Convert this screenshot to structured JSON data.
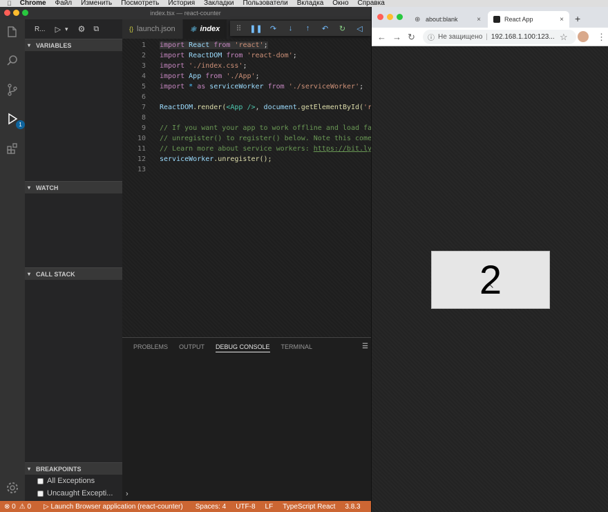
{
  "macos_menubar": {
    "app_name": "Chrome",
    "items": [
      "Файл",
      "Изменить",
      "Посмотреть",
      "История",
      "Закладки",
      "Пользователи",
      "Вкладка",
      "Окно",
      "Справка"
    ]
  },
  "vscode": {
    "title": "index.tsx — react-counter",
    "activity_badge": "1",
    "debug_config": "R...",
    "sections": {
      "variables": "VARIABLES",
      "watch": "WATCH",
      "call_stack": "CALL STACK",
      "breakpoints": "BREAKPOINTS"
    },
    "breakpoints": [
      {
        "label": "All Exceptions",
        "checked": false
      },
      {
        "label": "Uncaught Excepti...",
        "checked": false
      }
    ],
    "tabs": [
      {
        "icon": "{}",
        "label": "launch.json"
      },
      {
        "icon": "⚛",
        "label": "index"
      }
    ],
    "code_lines": [
      {
        "n": "1"
      },
      {
        "n": "2"
      },
      {
        "n": "3"
      },
      {
        "n": "4"
      },
      {
        "n": "5"
      },
      {
        "n": "6"
      },
      {
        "n": "7"
      },
      {
        "n": "8"
      },
      {
        "n": "9"
      },
      {
        "n": "10"
      },
      {
        "n": "11"
      },
      {
        "n": "12"
      },
      {
        "n": "13"
      }
    ],
    "code": {
      "l1": {
        "kw1": "import",
        "name": "React",
        "kw2": "from",
        "str": "'react'",
        "end": ";"
      },
      "l2": {
        "kw1": "import",
        "name": "ReactDOM",
        "kw2": "from",
        "str": "'react-dom'",
        "end": ";"
      },
      "l3": {
        "kw1": "import",
        "str": "'./index.css'",
        "end": ";"
      },
      "l4": {
        "kw1": "import",
        "name": "App",
        "kw2": "from",
        "str": "'./App'",
        "end": ";"
      },
      "l5": {
        "kw1": "import",
        "star": "*",
        "as": "as",
        "name": "serviceWorker",
        "kw2": "from",
        "str": "'./serviceWorker'",
        "end": ";"
      },
      "l7": {
        "obj": "ReactDOM",
        "method": ".render(",
        "tag": "<App />",
        "mid": ", ",
        "doc": "document",
        "get": ".getElementById(",
        "str": "'r"
      },
      "l9": "// If you want your app to work offline and load fa",
      "l10": "// unregister() to register() below. Note this come",
      "l11_text": "// Learn more about service workers: ",
      "l11_link": "https://bit.ly",
      "l12": {
        "obj": "serviceWorker",
        "call": ".unregister();"
      }
    },
    "panel_tabs": [
      "PROBLEMS",
      "OUTPUT",
      "DEBUG CONSOLE",
      "TERMINAL"
    ],
    "panel_active_tab": "DEBUG CONSOLE",
    "status": {
      "errors": "⊗ 0",
      "warnings": "⚠ 0",
      "launch": "▷ Launch Browser application (react-counter)",
      "spaces": "Spaces: 4",
      "encoding": "UTF-8",
      "eol": "LF",
      "language": "TypeScript React",
      "version": "3.8.3"
    },
    "colors": {
      "statusbar": "#cc6633",
      "accent": "#0e639c"
    }
  },
  "chrome": {
    "tabs": [
      {
        "label": "about:blank",
        "active": false
      },
      {
        "label": "React App",
        "active": true
      }
    ],
    "new_tab": "+",
    "omnibox": {
      "security": "Не защищено",
      "url": "192.168.1.100:123..."
    },
    "counter_value": "2"
  }
}
